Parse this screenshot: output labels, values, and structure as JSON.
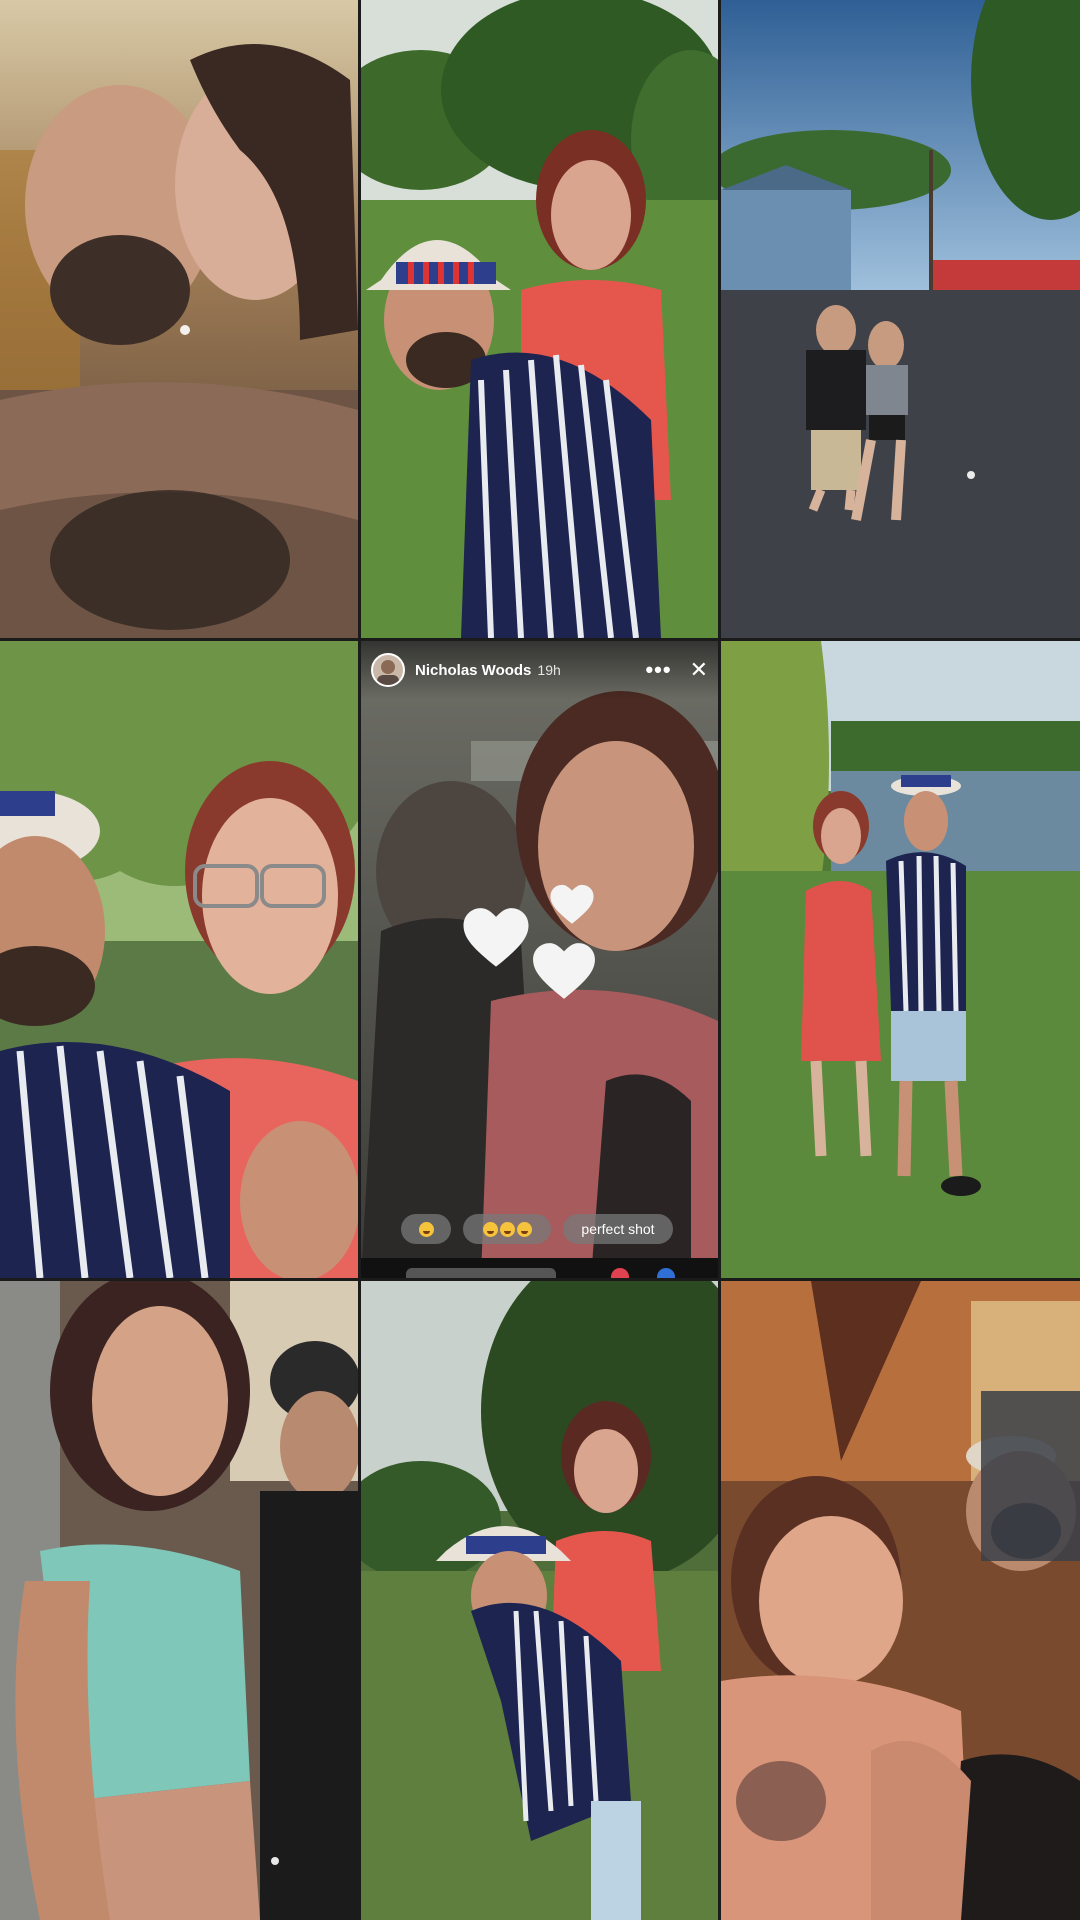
{
  "collage": {
    "layout": "3x3 photo grid",
    "colors": {
      "accent_red": "#e85a5a",
      "flag_blue": "#2c3e8c"
    }
  },
  "story": {
    "username": "Nicholas Woods",
    "time_ago": "19h",
    "more_icon": "more-horizontal-icon",
    "close_icon": "close-icon",
    "quick_replies": [
      {
        "icon": "wink-tongue-emoji"
      },
      {
        "icon": "heart-eyes-emoji-x3"
      },
      {
        "label": "perfect shot"
      }
    ],
    "sticker": "three-white-hearts"
  }
}
